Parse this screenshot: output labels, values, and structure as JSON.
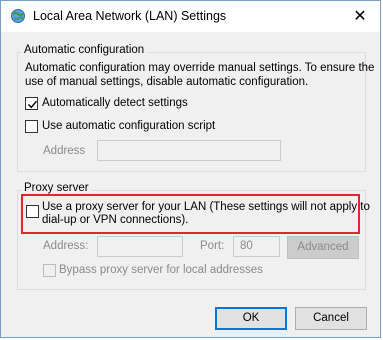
{
  "window": {
    "title": "Local Area Network (LAN) Settings",
    "close_glyph": "✕"
  },
  "automatic_configuration": {
    "group_label": "Automatic configuration",
    "description_line1": "Automatic configuration may override manual settings.  To ensure the",
    "description_line2": "use of manual settings, disable automatic configuration.",
    "auto_detect": {
      "label": "Automatically detect settings",
      "checked": true
    },
    "auto_script": {
      "label": "Use automatic configuration script",
      "checked": false
    },
    "address_label": "Address",
    "address_value": ""
  },
  "proxy_server": {
    "group_label": "Proxy server",
    "use_proxy": {
      "label_line1": "Use a proxy server for your LAN (These settings will not apply to",
      "label_line2": "dial-up or VPN connections).",
      "checked": false
    },
    "address_label": "Address:",
    "address_value": "",
    "port_label": "Port:",
    "port_value": "80",
    "advanced_label": "Advanced",
    "bypass_label": "Bypass proxy server for local addresses",
    "bypass_checked": false
  },
  "buttons": {
    "ok_label": "OK",
    "cancel_label": "Cancel"
  },
  "colors": {
    "highlight": "#e0262e",
    "default_button_border": "#0078d7"
  },
  "icons": {
    "title": "network-globe-icon",
    "close": "close-icon",
    "check": "checkmark-icon"
  }
}
